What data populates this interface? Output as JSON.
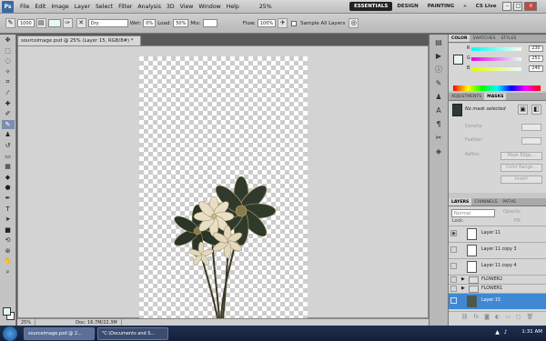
{
  "app": {
    "logo": "Ps"
  },
  "menu": [
    "File",
    "Edit",
    "Image",
    "Layer",
    "Select",
    "Filter",
    "Analysis",
    "3D",
    "View",
    "Window",
    "Help"
  ],
  "menubar_extra": {
    "zoom": "25%",
    "workspaces": [
      "ESSENTIALS",
      "DESIGN",
      "PAINTING"
    ],
    "cs_live": "CS Live"
  },
  "options": {
    "brush_size": "1000",
    "mode": "Dry",
    "wet_label": "Wet:",
    "wet_value": "0%",
    "load_label": "Load:",
    "load_value": "50%",
    "mix_label": "Mix:",
    "flow_label": "Flow:",
    "flow_value": "100%",
    "sample_label": "Sample All Layers"
  },
  "tools": [
    "move-icon",
    "marquee-icon",
    "lasso-icon",
    "quick-select-icon",
    "crop-icon",
    "eyedropper-icon",
    "healing-icon",
    "brush-icon",
    "mixer-brush-icon",
    "stamp-icon",
    "history-brush-icon",
    "eraser-icon",
    "gradient-icon",
    "blur-icon",
    "dodge-icon",
    "pen-icon",
    "type-icon",
    "path-select-icon",
    "shape-icon",
    "3d-rotate-icon",
    "3d-orbit-icon",
    "hand-icon",
    "zoom-icon"
  ],
  "document": {
    "tab_title": "sourceimage.psd @ 25% (Layer 15, RGB/8#) *",
    "status_zoom": "25%",
    "status_doc": "Doc: 16.7M/22.3M"
  },
  "color_panel": {
    "tabs": [
      "COLOR",
      "SWATCHES",
      "STYLES"
    ],
    "channels": [
      {
        "label": "R",
        "value": "230"
      },
      {
        "label": "G",
        "value": "251"
      },
      {
        "label": "B",
        "value": "240"
      }
    ],
    "fg_color": "#e6fbf0"
  },
  "adjust_panel": {
    "tabs": [
      "ADJUSTMENTS",
      "MASKS"
    ],
    "mask_text": "No mask selected",
    "density_label": "Density:",
    "feather_label": "Feather:",
    "refine_label": "Refine:",
    "buttons": [
      "Mask Edge...",
      "Color Range...",
      "Invert"
    ]
  },
  "layers_panel": {
    "tabs": [
      "LAYERS",
      "CHANNELS",
      "PATHS"
    ],
    "blend_mode": "Normal",
    "opacity_label": "Opacity:",
    "lock_label": "Lock:",
    "fill_label": "Fill:",
    "layers": [
      {
        "name": "Layer 11",
        "type": "layer",
        "visible": true
      },
      {
        "name": "Layer 11 copy 3",
        "type": "layer",
        "visible": false
      },
      {
        "name": "Layer 11 copy 4",
        "type": "layer",
        "visible": false
      },
      {
        "name": "FLOWER2",
        "type": "group",
        "visible": false
      },
      {
        "name": "FLOWER1",
        "type": "group",
        "visible": false
      },
      {
        "name": "Layer 15",
        "type": "layer",
        "visible": false,
        "selected": true
      }
    ]
  },
  "taskbar": {
    "items": [
      "sourceimage.psd @ 2...",
      "\"C:\\Documents and S..."
    ],
    "clock": "1:31 AM"
  }
}
